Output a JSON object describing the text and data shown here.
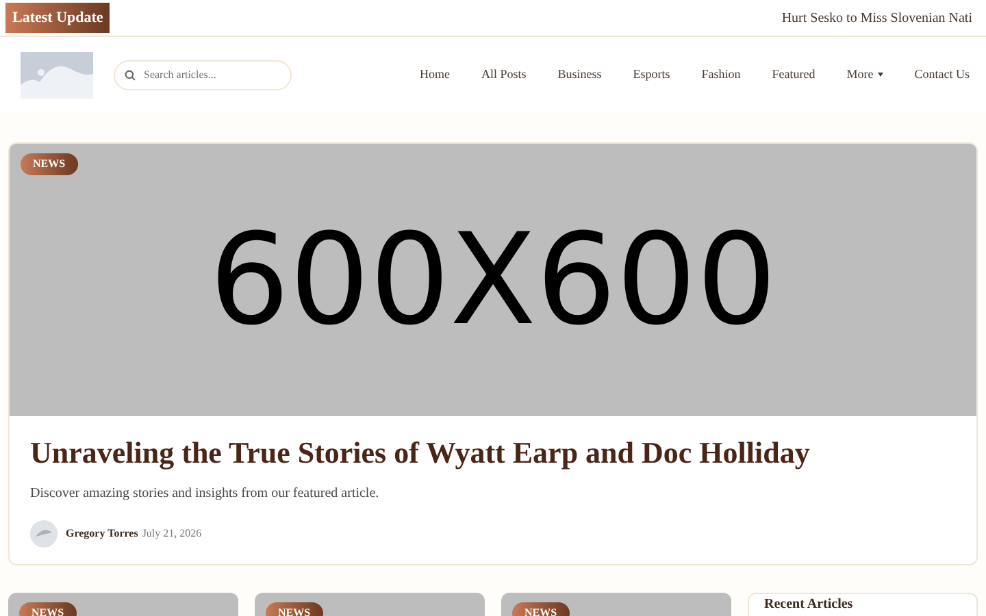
{
  "ticker": {
    "label": "Latest Update",
    "headline": "Hurt Sesko to Miss Slovenian Nati"
  },
  "search": {
    "placeholder": "Search articles..."
  },
  "nav": [
    {
      "label": "Home",
      "kind": "link"
    },
    {
      "label": "All Posts",
      "kind": "link"
    },
    {
      "label": "Business",
      "kind": "link"
    },
    {
      "label": "Esports",
      "kind": "link"
    },
    {
      "label": "Fashion",
      "kind": "link"
    },
    {
      "label": "Featured",
      "kind": "link"
    },
    {
      "label": "More",
      "kind": "dropdown"
    },
    {
      "label": "Contact Us",
      "kind": "link"
    }
  ],
  "featured": {
    "badge": "NEWS",
    "image_label": "600X600",
    "title": "Unraveling the True Stories of Wyatt Earp and Doc Holliday",
    "description": "Discover amazing stories and insights from our featured article.",
    "author": "Gregory Torres",
    "date": "July 21, 2026"
  },
  "cards": [
    {
      "badge": "NEWS"
    },
    {
      "badge": "NEWS"
    },
    {
      "badge": "NEWS"
    }
  ],
  "sidebar": {
    "title": "Recent Articles"
  }
}
